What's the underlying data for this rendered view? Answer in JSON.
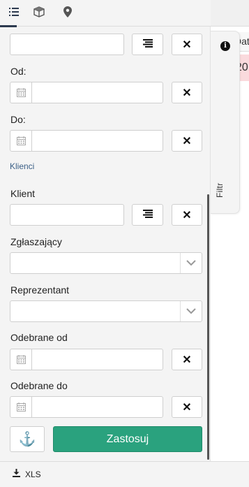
{
  "tabs": [
    {
      "icon": "list-icon",
      "active": true
    },
    {
      "icon": "box-icon",
      "active": false
    },
    {
      "icon": "map-marker-icon",
      "active": false
    }
  ],
  "background_table": {
    "column_header": "Dat",
    "row_value": "20"
  },
  "filter_tab": {
    "label": "Filtr",
    "icon": "info-icon"
  },
  "fields": {
    "top_input": {
      "value": "",
      "placeholder": ""
    },
    "od": {
      "label": "Od:",
      "value": ""
    },
    "do": {
      "label": "Do:",
      "value": ""
    }
  },
  "section_clients": "Klienci",
  "client_fields": {
    "klient": {
      "label": "Klient",
      "value": ""
    },
    "zglaszajacy": {
      "label": "Zgłaszający",
      "value": ""
    },
    "reprezentant": {
      "label": "Reprezentant",
      "value": ""
    },
    "odebrane_od": {
      "label": "Odebrane od",
      "value": ""
    },
    "odebrane_do": {
      "label": "Odebrane do",
      "value": ""
    }
  },
  "buttons": {
    "clear": "✕",
    "apply": "Zastosuj",
    "anchor": "⚓"
  },
  "footer": {
    "xls": "XLS"
  },
  "colors": {
    "apply_bg": "#2aa27e",
    "row_highlight": "#fadadd",
    "section_link": "#3a5f86"
  }
}
